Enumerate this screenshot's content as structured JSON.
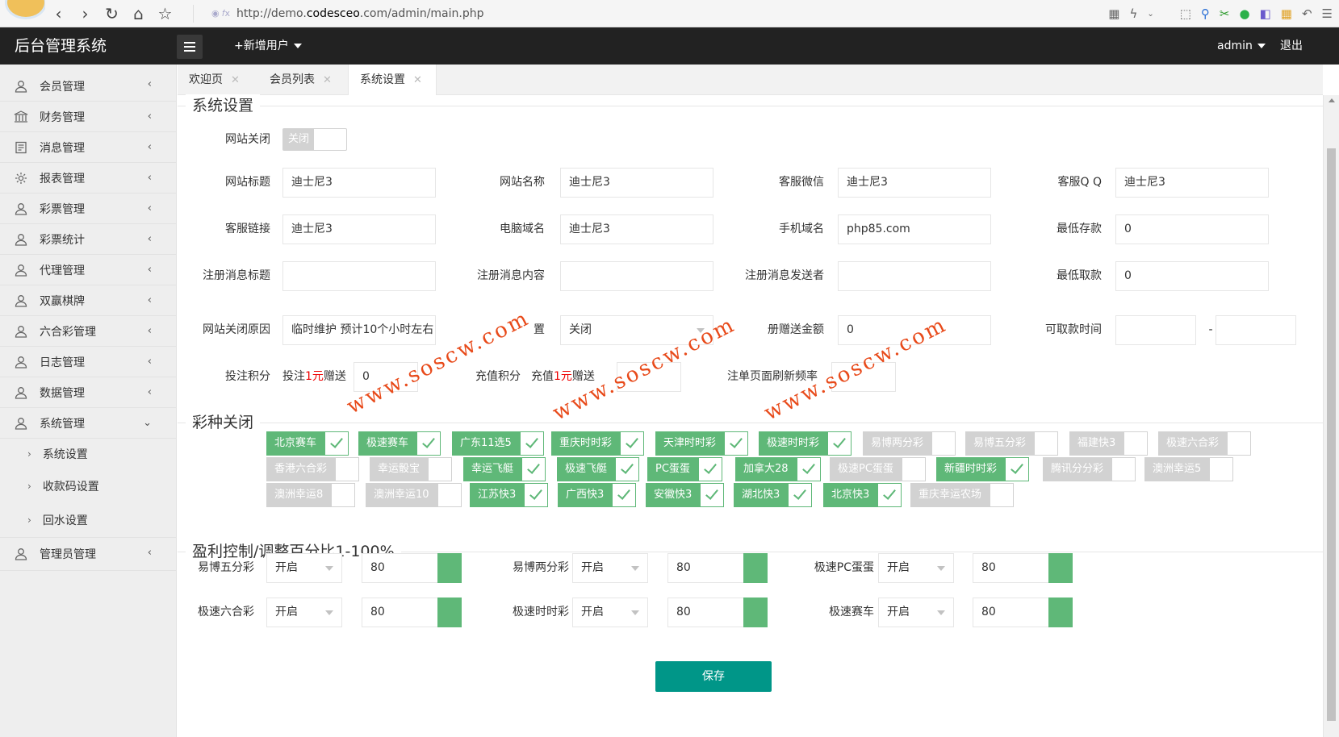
{
  "browser": {
    "url_prefix": "http://demo.",
    "url_host": "codesceo",
    "url_suffix": ".com/admin/main.php"
  },
  "header": {
    "brand": "后台管理系统",
    "add_user": "+新增用户",
    "admin": "admin",
    "logout": "退出"
  },
  "sidebar": {
    "items": [
      {
        "label": "会员管理",
        "icon": "user-icon"
      },
      {
        "label": "财务管理",
        "icon": "library-icon"
      },
      {
        "label": "消息管理",
        "icon": "message-icon"
      },
      {
        "label": "报表管理",
        "icon": "gear-icon"
      },
      {
        "label": "彩票管理",
        "icon": "user-icon"
      },
      {
        "label": "彩票统计",
        "icon": "user-icon"
      },
      {
        "label": "代理管理",
        "icon": "user-icon"
      },
      {
        "label": "双赢棋牌",
        "icon": "user-icon"
      },
      {
        "label": "六合彩管理",
        "icon": "user-icon"
      },
      {
        "label": "日志管理",
        "icon": "user-icon"
      },
      {
        "label": "数据管理",
        "icon": "user-icon"
      },
      {
        "label": "系统管理",
        "icon": "user-icon"
      }
    ],
    "sub_items": [
      "系统设置",
      "收款码设置",
      "回水设置"
    ],
    "last_item": "管理员管理"
  },
  "tabs": [
    {
      "label": "欢迎页"
    },
    {
      "label": "会员列表"
    },
    {
      "label": "系统设置"
    }
  ],
  "sections": {
    "system": "系统设置",
    "lottery_close": "彩种关闭",
    "profit": "盈利控制/调整百分比1-100%"
  },
  "form": {
    "site_close_label": "网站关闭",
    "site_close_toggle": "关闭",
    "site_title_label": "网站标题",
    "site_title": "迪士尼3",
    "site_name_label": "网站名称",
    "site_name": "迪士尼3",
    "cs_wechat_label": "客服微信",
    "cs_wechat": "迪士尼3",
    "cs_qq_label": "客服Q Q",
    "cs_qq": "迪士尼3",
    "cs_link_label": "客服链接",
    "cs_link": "迪士尼3",
    "pc_domain_label": "电脑域名",
    "pc_domain": "迪士尼3",
    "mobile_domain_label": "手机域名",
    "mobile_domain": "php85.com",
    "min_deposit_label": "最低存款",
    "min_deposit": "0",
    "reg_msg_title_label": "注册消息标题",
    "reg_msg_title": "",
    "reg_msg_content_label": "注册消息内容",
    "reg_msg_content": "",
    "reg_msg_sender_label": "注册消息发送者",
    "reg_msg_sender": "",
    "min_withdraw_label": "最低取款",
    "min_withdraw": "0",
    "close_reason_label": "网站关闭原因",
    "close_reason": "临时维护 预计10个小时左右",
    "hidden_label_tail": "置",
    "reg_setting_value": "关闭",
    "gift_amount_label_tail": "册赠送金额",
    "gift_amount": "0",
    "withdraw_time_label": "可取款时间",
    "withdraw_time_from": "",
    "withdraw_time_sep": "-",
    "withdraw_time_to": "",
    "bet_points_label": "投注积分",
    "bet_points_pre": "投注",
    "bet_points_red": "1元",
    "bet_points_post": "赠送",
    "bet_points": "0",
    "recharge_points_label": "充值积分",
    "recharge_pre": "充值",
    "recharge_red": "1元",
    "recharge_post": "赠送",
    "refresh_label": "注单页面刷新频率"
  },
  "lotteries": [
    {
      "name": "北京赛车",
      "on": true
    },
    {
      "name": "极速赛车",
      "on": true
    },
    {
      "name": "广东11选5",
      "on": true
    },
    {
      "name": "重庆时时彩",
      "on": true
    },
    {
      "name": "天津时时彩",
      "on": true
    },
    {
      "name": "极速时时彩",
      "on": true
    },
    {
      "name": "易博两分彩",
      "on": false
    },
    {
      "name": "易博五分彩",
      "on": false
    },
    {
      "name": "福建快3",
      "on": false
    },
    {
      "name": "极速六合彩",
      "on": false
    },
    {
      "name": "香港六合彩",
      "on": false
    },
    {
      "name": "幸运骰宝",
      "on": false
    },
    {
      "name": "幸运飞艇",
      "on": true
    },
    {
      "name": "极速飞艇",
      "on": true
    },
    {
      "name": "PC蛋蛋",
      "on": true
    },
    {
      "name": "加拿大28",
      "on": true
    },
    {
      "name": "极速PC蛋蛋",
      "on": false
    },
    {
      "name": "新疆时时彩",
      "on": true
    },
    {
      "name": "腾讯分分彩",
      "on": false
    },
    {
      "name": "澳洲幸运5",
      "on": false
    },
    {
      "name": "澳洲幸运8",
      "on": false
    },
    {
      "name": "澳洲幸运10",
      "on": false
    },
    {
      "name": "江苏快3",
      "on": true
    },
    {
      "name": "广西快3",
      "on": true
    },
    {
      "name": "安徽快3",
      "on": true
    },
    {
      "name": "湖北快3",
      "on": true
    },
    {
      "name": "北京快3",
      "on": true
    },
    {
      "name": "重庆幸运农场",
      "on": false
    }
  ],
  "profit": [
    {
      "label": "易博五分彩",
      "status": "开启",
      "value": "80"
    },
    {
      "label": "易博两分彩",
      "status": "开启",
      "value": "80"
    },
    {
      "label": "极速PC蛋蛋",
      "status": "开启",
      "value": "80"
    },
    {
      "label": "极速六合彩",
      "status": "开启",
      "value": "80"
    },
    {
      "label": "极速时时彩",
      "status": "开启",
      "value": "80"
    },
    {
      "label": "极速赛车",
      "status": "开启",
      "value": "80"
    }
  ],
  "save_label": "保存",
  "watermark": "www.soscw.com",
  "colors": {
    "accent_green": "#5fb878",
    "save_teal": "#009688",
    "topbar": "#222222"
  }
}
